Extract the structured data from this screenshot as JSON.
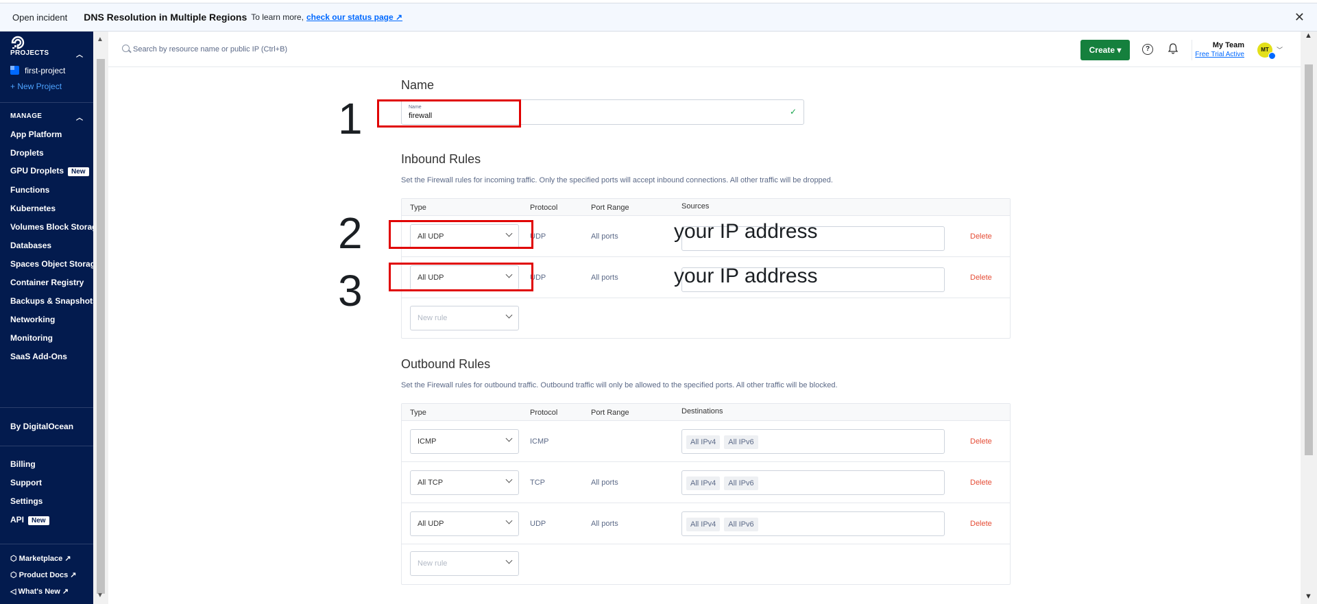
{
  "banner": {
    "tag": "Open incident",
    "title": "DNS Resolution in Multiple Regions",
    "more": "To learn more,",
    "link": "check our status page ↗"
  },
  "sidebar": {
    "projects_label": "PROJECTS",
    "project_name": "first-project",
    "new_project": "+  New Project",
    "manage_label": "MANAGE",
    "items": [
      {
        "label": "App Platform"
      },
      {
        "label": "Droplets"
      },
      {
        "label": "GPU Droplets",
        "badge": "New"
      },
      {
        "label": "Functions"
      },
      {
        "label": "Kubernetes"
      },
      {
        "label": "Volumes Block Storage"
      },
      {
        "label": "Databases"
      },
      {
        "label": "Spaces Object Storage"
      },
      {
        "label": "Container Registry"
      },
      {
        "label": "Backups & Snapshots"
      },
      {
        "label": "Networking"
      },
      {
        "label": "Monitoring"
      },
      {
        "label": "SaaS Add-Ons"
      }
    ],
    "by_do": "By DigitalOcean",
    "billing": "Billing",
    "support": "Support",
    "settings": "Settings",
    "api": "API",
    "api_badge": "New",
    "marketplace": "Marketplace ↗",
    "product_docs": "Product Docs ↗",
    "whats_new": "What's New ↗"
  },
  "topbar": {
    "search_placeholder": "Search by resource name or public IP (Ctrl+B)",
    "create_label": "Create ▾",
    "help_icon": "?",
    "team_name": "My Team",
    "team_status": "Free Trial Active",
    "avatar_initials": "MT"
  },
  "name_section": {
    "heading": "Name",
    "field_label": "Name",
    "field_value": "firewall"
  },
  "inbound": {
    "heading": "Inbound Rules",
    "description": "Set the Firewall rules for incoming traffic. Only the specified ports will accept inbound connections. All other traffic will be dropped.",
    "col_type": "Type",
    "col_protocol": "Protocol",
    "col_port": "Port Range",
    "col_sources": "Sources",
    "rows": [
      {
        "type": "All UDP",
        "protocol": "UDP",
        "port": "All ports",
        "delete": "Delete"
      },
      {
        "type": "All UDP",
        "protocol": "UDP",
        "port": "All ports",
        "delete": "Delete"
      }
    ],
    "new_rule": "New rule"
  },
  "outbound": {
    "heading": "Outbound Rules",
    "description": "Set the Firewall rules for outbound traffic. Outbound traffic will only be allowed to the specified ports. All other traffic will be blocked.",
    "col_type": "Type",
    "col_protocol": "Protocol",
    "col_port": "Port Range",
    "col_dest": "Destinations",
    "rows": [
      {
        "type": "ICMP",
        "protocol": "ICMP",
        "port": "",
        "chip1": "All IPv4",
        "chip2": "All IPv6",
        "delete": "Delete"
      },
      {
        "type": "All TCP",
        "protocol": "TCP",
        "port": "All ports",
        "chip1": "All IPv4",
        "chip2": "All IPv6",
        "delete": "Delete"
      },
      {
        "type": "All UDP",
        "protocol": "UDP",
        "port": "All ports",
        "chip1": "All IPv4",
        "chip2": "All IPv6",
        "delete": "Delete"
      }
    ],
    "new_rule": "New rule"
  },
  "annotations": {
    "n1": "1",
    "n2": "2",
    "n3": "3",
    "ip1": "your IP address",
    "ip2": "your IP address"
  },
  "colors": {
    "sidebar_bg": "#031b4e",
    "create_btn": "#15803d",
    "delete_red": "#e54c35",
    "annotation_red": "#e00000",
    "link_blue": "#0069ff"
  }
}
